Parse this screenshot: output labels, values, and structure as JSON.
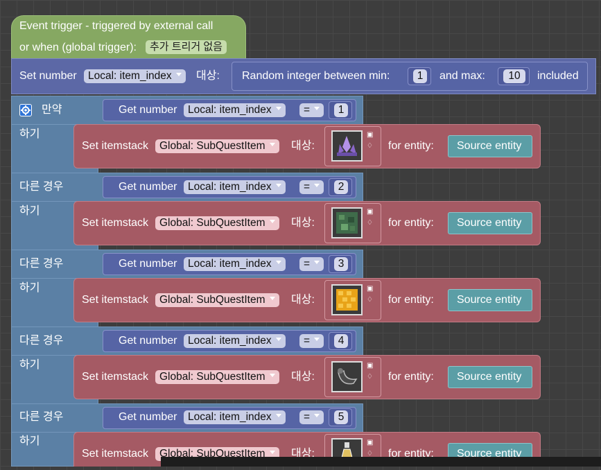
{
  "event": {
    "line1": "Event trigger - triggered by external call",
    "line2": "or when (global trigger):",
    "trigger_chip": "추가 트리거 없음"
  },
  "set_number": {
    "label": "Set number",
    "variable": "Local: item_index",
    "target_label": "대상:",
    "random_label": "Random integer between min:",
    "min": "1",
    "and_max": "and max:",
    "max": "10",
    "included": "included"
  },
  "if_block": {
    "if_label": "만약",
    "do_label": "하기",
    "else_if_label": "다른 경우",
    "branches": [
      {
        "get_label": "Get number",
        "variable": "Local: item_index",
        "op": "=",
        "value": "1",
        "set_label": "Set itemstack",
        "itemstack": "Global: SubQuestItem",
        "target_label": "대상:",
        "for_entity": "for entity:",
        "entity": "Source entity",
        "item_icon": "amethyst-cluster-icon"
      },
      {
        "get_label": "Get number",
        "variable": "Local: item_index",
        "op": "=",
        "value": "2",
        "set_label": "Set itemstack",
        "itemstack": "Global: SubQuestItem",
        "target_label": "대상:",
        "for_entity": "for entity:",
        "entity": "Source entity",
        "item_icon": "mossy-block-icon"
      },
      {
        "get_label": "Get number",
        "variable": "Local: item_index",
        "op": "=",
        "value": "3",
        "set_label": "Set itemstack",
        "itemstack": "Global: SubQuestItem",
        "target_label": "대상:",
        "for_entity": "for entity:",
        "entity": "Source entity",
        "item_icon": "honeycomb-block-icon"
      },
      {
        "get_label": "Get number",
        "variable": "Local: item_index",
        "op": "=",
        "value": "4",
        "set_label": "Set itemstack",
        "itemstack": "Global: SubQuestItem",
        "target_label": "대상:",
        "for_entity": "for entity:",
        "entity": "Source entity",
        "item_icon": "goat-horn-icon"
      },
      {
        "get_label": "Get number",
        "variable": "Local: item_index",
        "op": "=",
        "value": "5",
        "set_label": "Set itemstack",
        "itemstack": "Global: SubQuestItem",
        "target_label": "대상:",
        "for_entity": "for entity:",
        "entity": "Source entity",
        "item_icon": "potion-bottle-icon"
      }
    ]
  },
  "colors": {
    "event": "#86a862",
    "set_number": "#5c68a6",
    "if_block": "#5b80a5",
    "set_itemstack": "#a55a64",
    "entity": "#5b9ea6"
  }
}
